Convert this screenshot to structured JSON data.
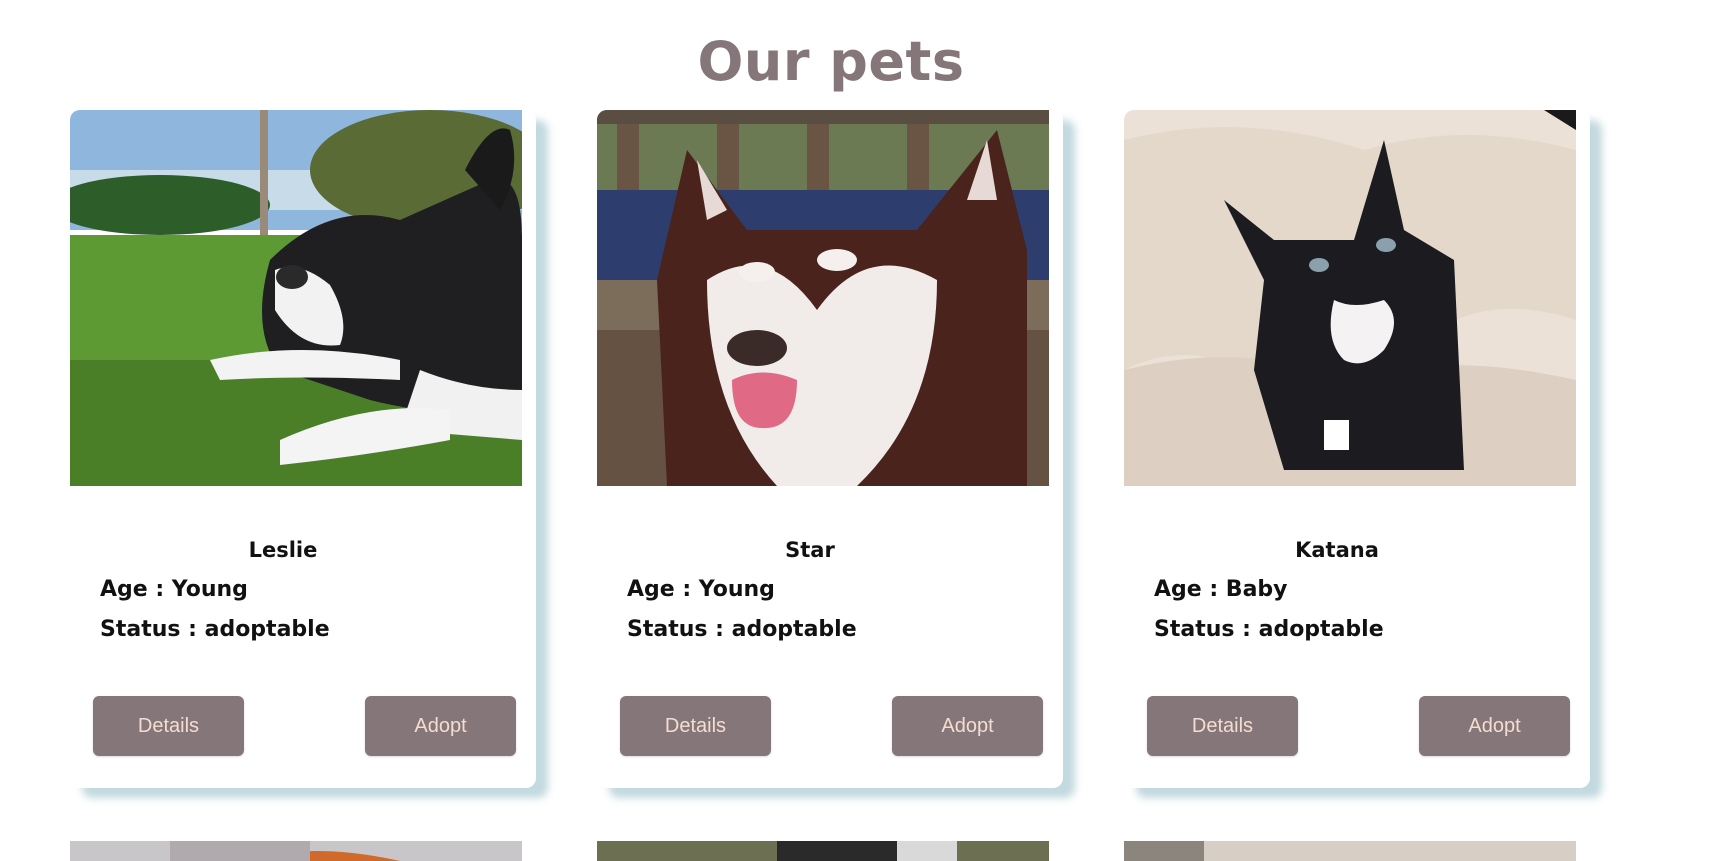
{
  "page": {
    "title": "Our pets"
  },
  "pets": [
    {
      "name": "Leslie",
      "age": "Age : Young",
      "status": "Status : adoptable",
      "photo_icon": "dog-photo-icon",
      "details_label": "Details",
      "adopt_label": "Adopt"
    },
    {
      "name": "Star",
      "age": "Age : Young",
      "status": "Status : adoptable",
      "photo_icon": "husky-photo-icon",
      "details_label": "Details",
      "adopt_label": "Adopt"
    },
    {
      "name": "Katana",
      "age": "Age : Baby",
      "status": "Status : adoptable",
      "photo_icon": "kitten-photo-icon",
      "details_label": "Details",
      "adopt_label": "Adopt"
    }
  ],
  "colors": {
    "title": "#857679",
    "button_bg": "#857679",
    "button_text": "#f4ddd0",
    "card_shadow": "#8fb8c6"
  }
}
